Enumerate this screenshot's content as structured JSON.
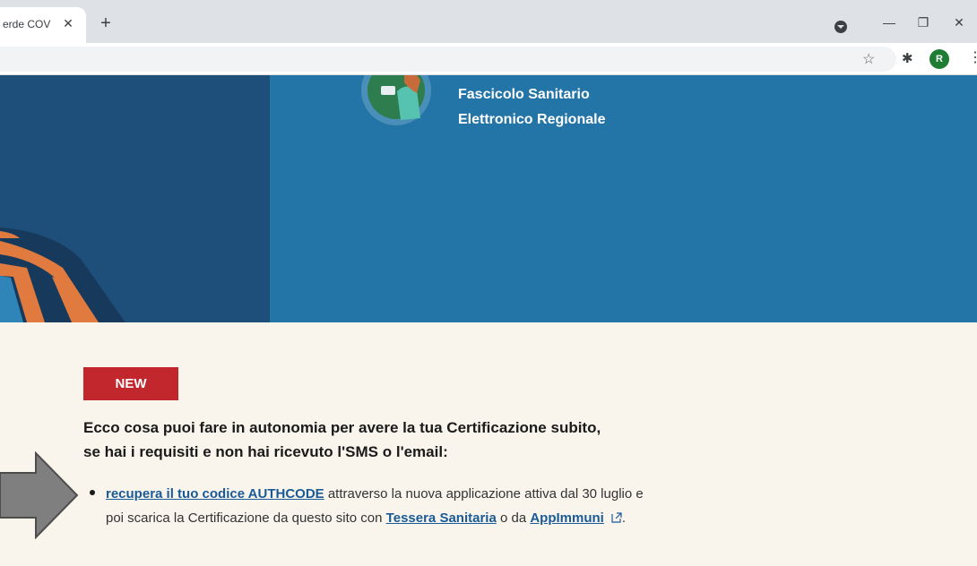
{
  "browser": {
    "tab_title": "erde COV",
    "tab_close_glyph": "✕",
    "new_tab_glyph": "+",
    "minimize_glyph": "—",
    "restore_glyph": "❐",
    "close_glyph": "✕",
    "bookmark_glyph": "☆",
    "extensions_glyph": "✱",
    "avatar_letter": "R",
    "menu_glyph": "⋮"
  },
  "site": {
    "title_line1": "Fascicolo Sanitario",
    "title_line2": "Elettronico Regionale"
  },
  "content": {
    "badge": "NEW",
    "heading": "Ecco cosa puoi fare in autonomia per avere la tua Certificazione subito, se hai i requisiti e non hai ricevuto l'SMS o l'email:",
    "bullet": {
      "link1": "recupera il tuo codice AUTHCODE",
      "text1": " attraverso la nuova applicazione attiva dal 30 luglio e poi scarica la Certificazione da questo sito con ",
      "link2": "Tessera Sanitaria",
      "text2": " o da ",
      "link3": "AppImmuni",
      "text3": "."
    }
  },
  "colors": {
    "hero_blue": "#2475a7",
    "hero_dark": "#1e4f7a",
    "badge_red": "#c1272d",
    "link_blue": "#1a5a96",
    "page_bg": "#f9f5ed"
  }
}
